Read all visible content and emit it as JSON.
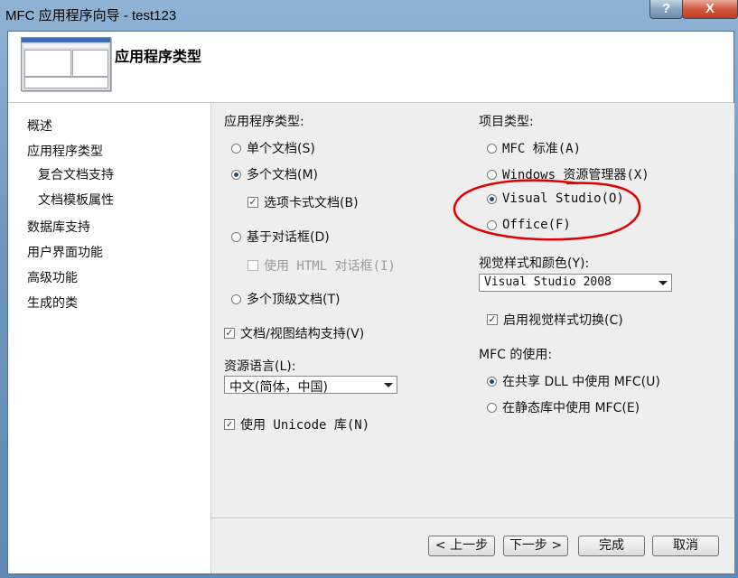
{
  "window": {
    "title": "MFC 应用程序向导 - test123",
    "help_label": "?",
    "close_label": "X"
  },
  "header": {
    "title": "应用程序类型"
  },
  "nav": {
    "items": [
      {
        "label": "概述"
      },
      {
        "label": "应用程序类型"
      },
      {
        "label": "复合文档支持"
      },
      {
        "label": "文档模板属性"
      },
      {
        "label": "数据库支持"
      },
      {
        "label": "用户界面功能"
      },
      {
        "label": "高级功能"
      },
      {
        "label": "生成的类"
      }
    ]
  },
  "app_type": {
    "label": "应用程序类型:",
    "single": "单个文档(S)",
    "multi": "多个文档(M)",
    "tabbed": "选项卡式文档(B)",
    "dialog": "基于对话框(D)",
    "html_dialog": "使用 HTML 对话框(I)",
    "multi_top": "多个顶级文档(T)",
    "docview": "文档/视图结构支持(V)",
    "resource_lang_label": "资源语言(L):",
    "resource_lang_value": "中文(简体，中国)",
    "unicode": "使用 Unicode 库(N)"
  },
  "project_type": {
    "label": "项目类型:",
    "mfc_standard": "MFC 标准(A)",
    "explorer": "Windows 资源管理器(X)",
    "visual_studio": "Visual Studio(O)",
    "office": "Office(F)",
    "visual_style_label": "视觉样式和颜色(Y):",
    "visual_style_value": "Visual Studio 2008",
    "enable_style_switch": "启用视觉样式切换(C)",
    "mfc_use_label": "MFC 的使用:",
    "shared_dll": "在共享 DLL 中使用 MFC(U)",
    "static_lib": "在静态库中使用 MFC(E)"
  },
  "buttons": {
    "prev": "< 上一步",
    "next": "下一步 >",
    "finish": "完成",
    "cancel": "取消"
  },
  "colors": {
    "annotation": "#e00000"
  }
}
